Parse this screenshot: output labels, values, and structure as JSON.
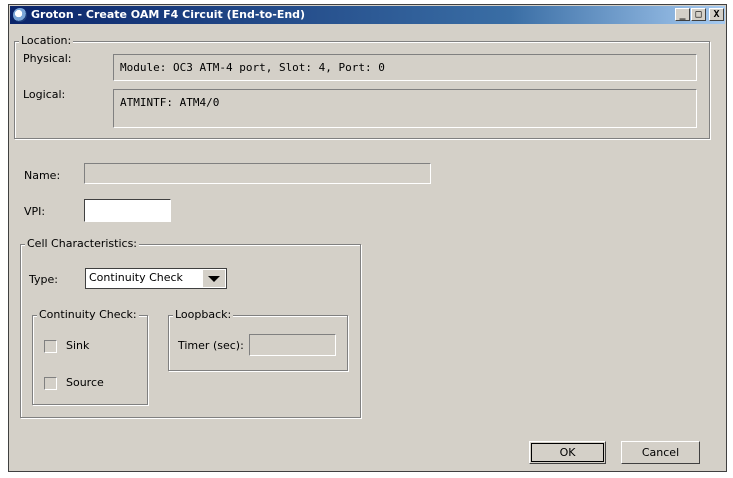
{
  "window": {
    "title": "Groton - Create OAM F4 Circuit (End-to-End)",
    "controls": {
      "minimize": "_",
      "maximize": "□",
      "close": "X"
    }
  },
  "location": {
    "legend": "Location:",
    "physical_label": "Physical:",
    "physical_value": "Module: OC3 ATM-4 port, Slot: 4, Port: 0",
    "logical_label": "Logical:",
    "logical_value": "ATMINTF: ATM4/0"
  },
  "form": {
    "name_label": "Name:",
    "name_value": "",
    "vpi_label": "VPI:",
    "vpi_value": ""
  },
  "cell": {
    "legend": "Cell Characteristics:",
    "type_label": "Type:",
    "type_value": "Continuity Check",
    "continuity": {
      "legend": "Continuity Check:",
      "sink_label": "Sink",
      "source_label": "Source"
    },
    "loopback": {
      "legend": "Loopback:",
      "timer_label": "Timer (sec):",
      "timer_value": ""
    }
  },
  "buttons": {
    "ok": "OK",
    "cancel": "Cancel"
  }
}
